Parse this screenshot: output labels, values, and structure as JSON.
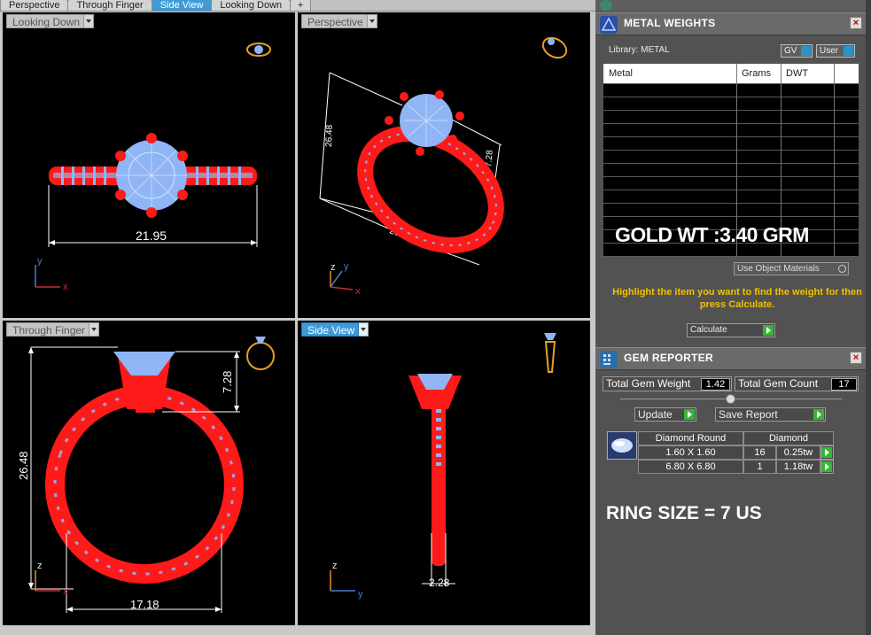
{
  "tabs": [
    {
      "label": "Perspective",
      "active": false
    },
    {
      "label": "Through Finger",
      "active": false
    },
    {
      "label": "Side View",
      "active": true
    },
    {
      "label": "Looking Down",
      "active": false
    },
    {
      "label": "+",
      "active": false
    }
  ],
  "viewports": {
    "looking_down": {
      "label": "Looking Down",
      "active": false,
      "dim_width": "21.95",
      "axis_x": "x",
      "axis_y": "y"
    },
    "perspective": {
      "label": "Perspective",
      "active": false,
      "dim_width": "21.95",
      "dim_height": "26.48",
      "dim_small": "7.28",
      "axis_x": "x",
      "axis_y": "y",
      "axis_z": "z"
    },
    "through_finger": {
      "label": "Through Finger",
      "active": false,
      "dim_height": "26.48",
      "dim_top": "7.28",
      "dim_width": "17.18",
      "axis_x": "x",
      "axis_z": "z"
    },
    "side_view": {
      "label": "Side View",
      "active": true,
      "dim_width": "2.28",
      "axis_y": "y",
      "axis_z": "z"
    }
  },
  "metal_weights": {
    "title": "METAL WEIGHTS",
    "library": "Library: METAL",
    "gv": "GV",
    "user": "User",
    "columns": [
      "Metal",
      "Grams",
      "DWT"
    ],
    "overlay_text": "GOLD WT :3.40 GRM",
    "use_object_materials": "Use Object Materials",
    "hint": "Highlight the item you want to find the weight for then press Calculate.",
    "calculate": "Calculate"
  },
  "gem_reporter": {
    "title": "GEM REPORTER",
    "total_gem_weight_label": "Total Gem Weight",
    "total_gem_weight": "1.42",
    "total_gem_count_label": "Total Gem Count",
    "total_gem_count": "17",
    "update": "Update",
    "save_report": "Save Report",
    "table_header": [
      "Diamond Round",
      "Diamond"
    ],
    "rows": [
      {
        "size": "1.60 X 1.60",
        "count": "16",
        "weight": "0.25tw"
      },
      {
        "size": "6.80 X 6.80",
        "count": "1",
        "weight": "1.18tw"
      }
    ],
    "ring_size": "RING SIZE = 7 US"
  },
  "colors": {
    "viewport_bg": "#000000",
    "metal": "#ff1a1a",
    "gem": "#8fb5f5",
    "active_tab": "#3e9bd8",
    "panel_bg": "#525252",
    "hint_text": "#f0c000"
  }
}
